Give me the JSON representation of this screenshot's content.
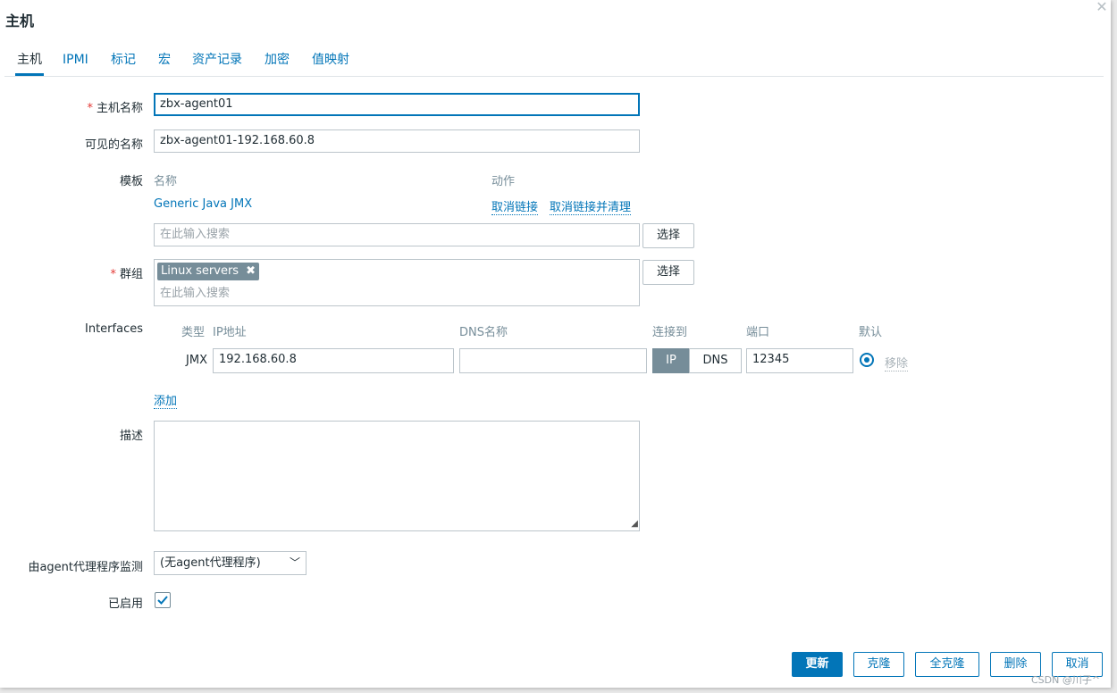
{
  "dialog": {
    "title": "主机",
    "close_icon": "close-icon"
  },
  "tabs": [
    "主机",
    "IPMI",
    "标记",
    "宏",
    "资产记录",
    "加密",
    "值映射"
  ],
  "host_name": {
    "label": "主机名称",
    "value": "zbx-agent01"
  },
  "visible_name": {
    "label": "可见的名称",
    "value": "zbx-agent01-192.168.60.8"
  },
  "templates": {
    "label": "模板",
    "col_name": "名称",
    "col_action": "动作",
    "items": [
      {
        "name": "Generic Java JMX",
        "unlink": "取消链接",
        "unlink_clear": "取消链接并清理"
      }
    ],
    "search_placeholder": "在此输入搜索",
    "select_button": "选择"
  },
  "groups": {
    "label": "群组",
    "chips": [
      "Linux servers"
    ],
    "search_placeholder": "在此输入搜索",
    "select_button": "选择"
  },
  "interfaces": {
    "label": "Interfaces",
    "col_type": "类型",
    "col_ip": "IP地址",
    "col_dns": "DNS名称",
    "col_connect": "连接到",
    "col_port": "端口",
    "col_default": "默认",
    "row": {
      "type": "JMX",
      "ip": "192.168.60.8",
      "dns": "",
      "connect_ip": "IP",
      "connect_dns": "DNS",
      "connect_selected": "IP",
      "port": "12345",
      "remove": "移除"
    },
    "add_link": "添加"
  },
  "description": {
    "label": "描述",
    "value": ""
  },
  "proxy": {
    "label": "由agent代理程序监测",
    "selected": "(无agent代理程序)"
  },
  "enabled": {
    "label": "已启用",
    "checked": true
  },
  "buttons": {
    "update": "更新",
    "clone": "克隆",
    "full_clone": "全克隆",
    "delete": "删除",
    "cancel": "取消"
  },
  "watermark": "CSDN @川子^",
  "colors": {
    "accent": "#0275b8",
    "required": "#e33734",
    "chip": "#768d99"
  }
}
